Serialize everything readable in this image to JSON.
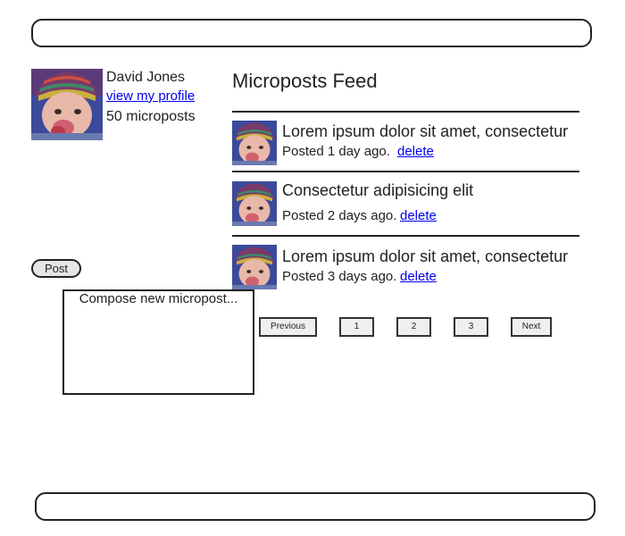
{
  "profile": {
    "name": "David Jones",
    "view_profile_link": "view my profile",
    "micropost_count": "50 microposts"
  },
  "compose": {
    "placeholder": "Compose new micropost...",
    "post_button": "Post"
  },
  "feed": {
    "title": "Microposts Feed",
    "posts": [
      {
        "content": "Lorem ipsum dolor sit amet, consectetur",
        "posted": "Posted 1 day ago.",
        "delete_label": "delete"
      },
      {
        "content": "Consectetur adipisicing elit",
        "posted": "Posted 2 days ago.",
        "delete_label": "delete"
      },
      {
        "content": "Lorem ipsum dolor sit amet, consectetur",
        "posted": "Posted 3 days ago.",
        "delete_label": "delete"
      }
    ]
  },
  "pagination": {
    "previous": "Previous",
    "pages": [
      "1",
      "2",
      "3"
    ],
    "next": "Next"
  },
  "colors": {
    "link": "#0000ee",
    "border": "#222222",
    "button_bg": "#e6e6e6"
  }
}
